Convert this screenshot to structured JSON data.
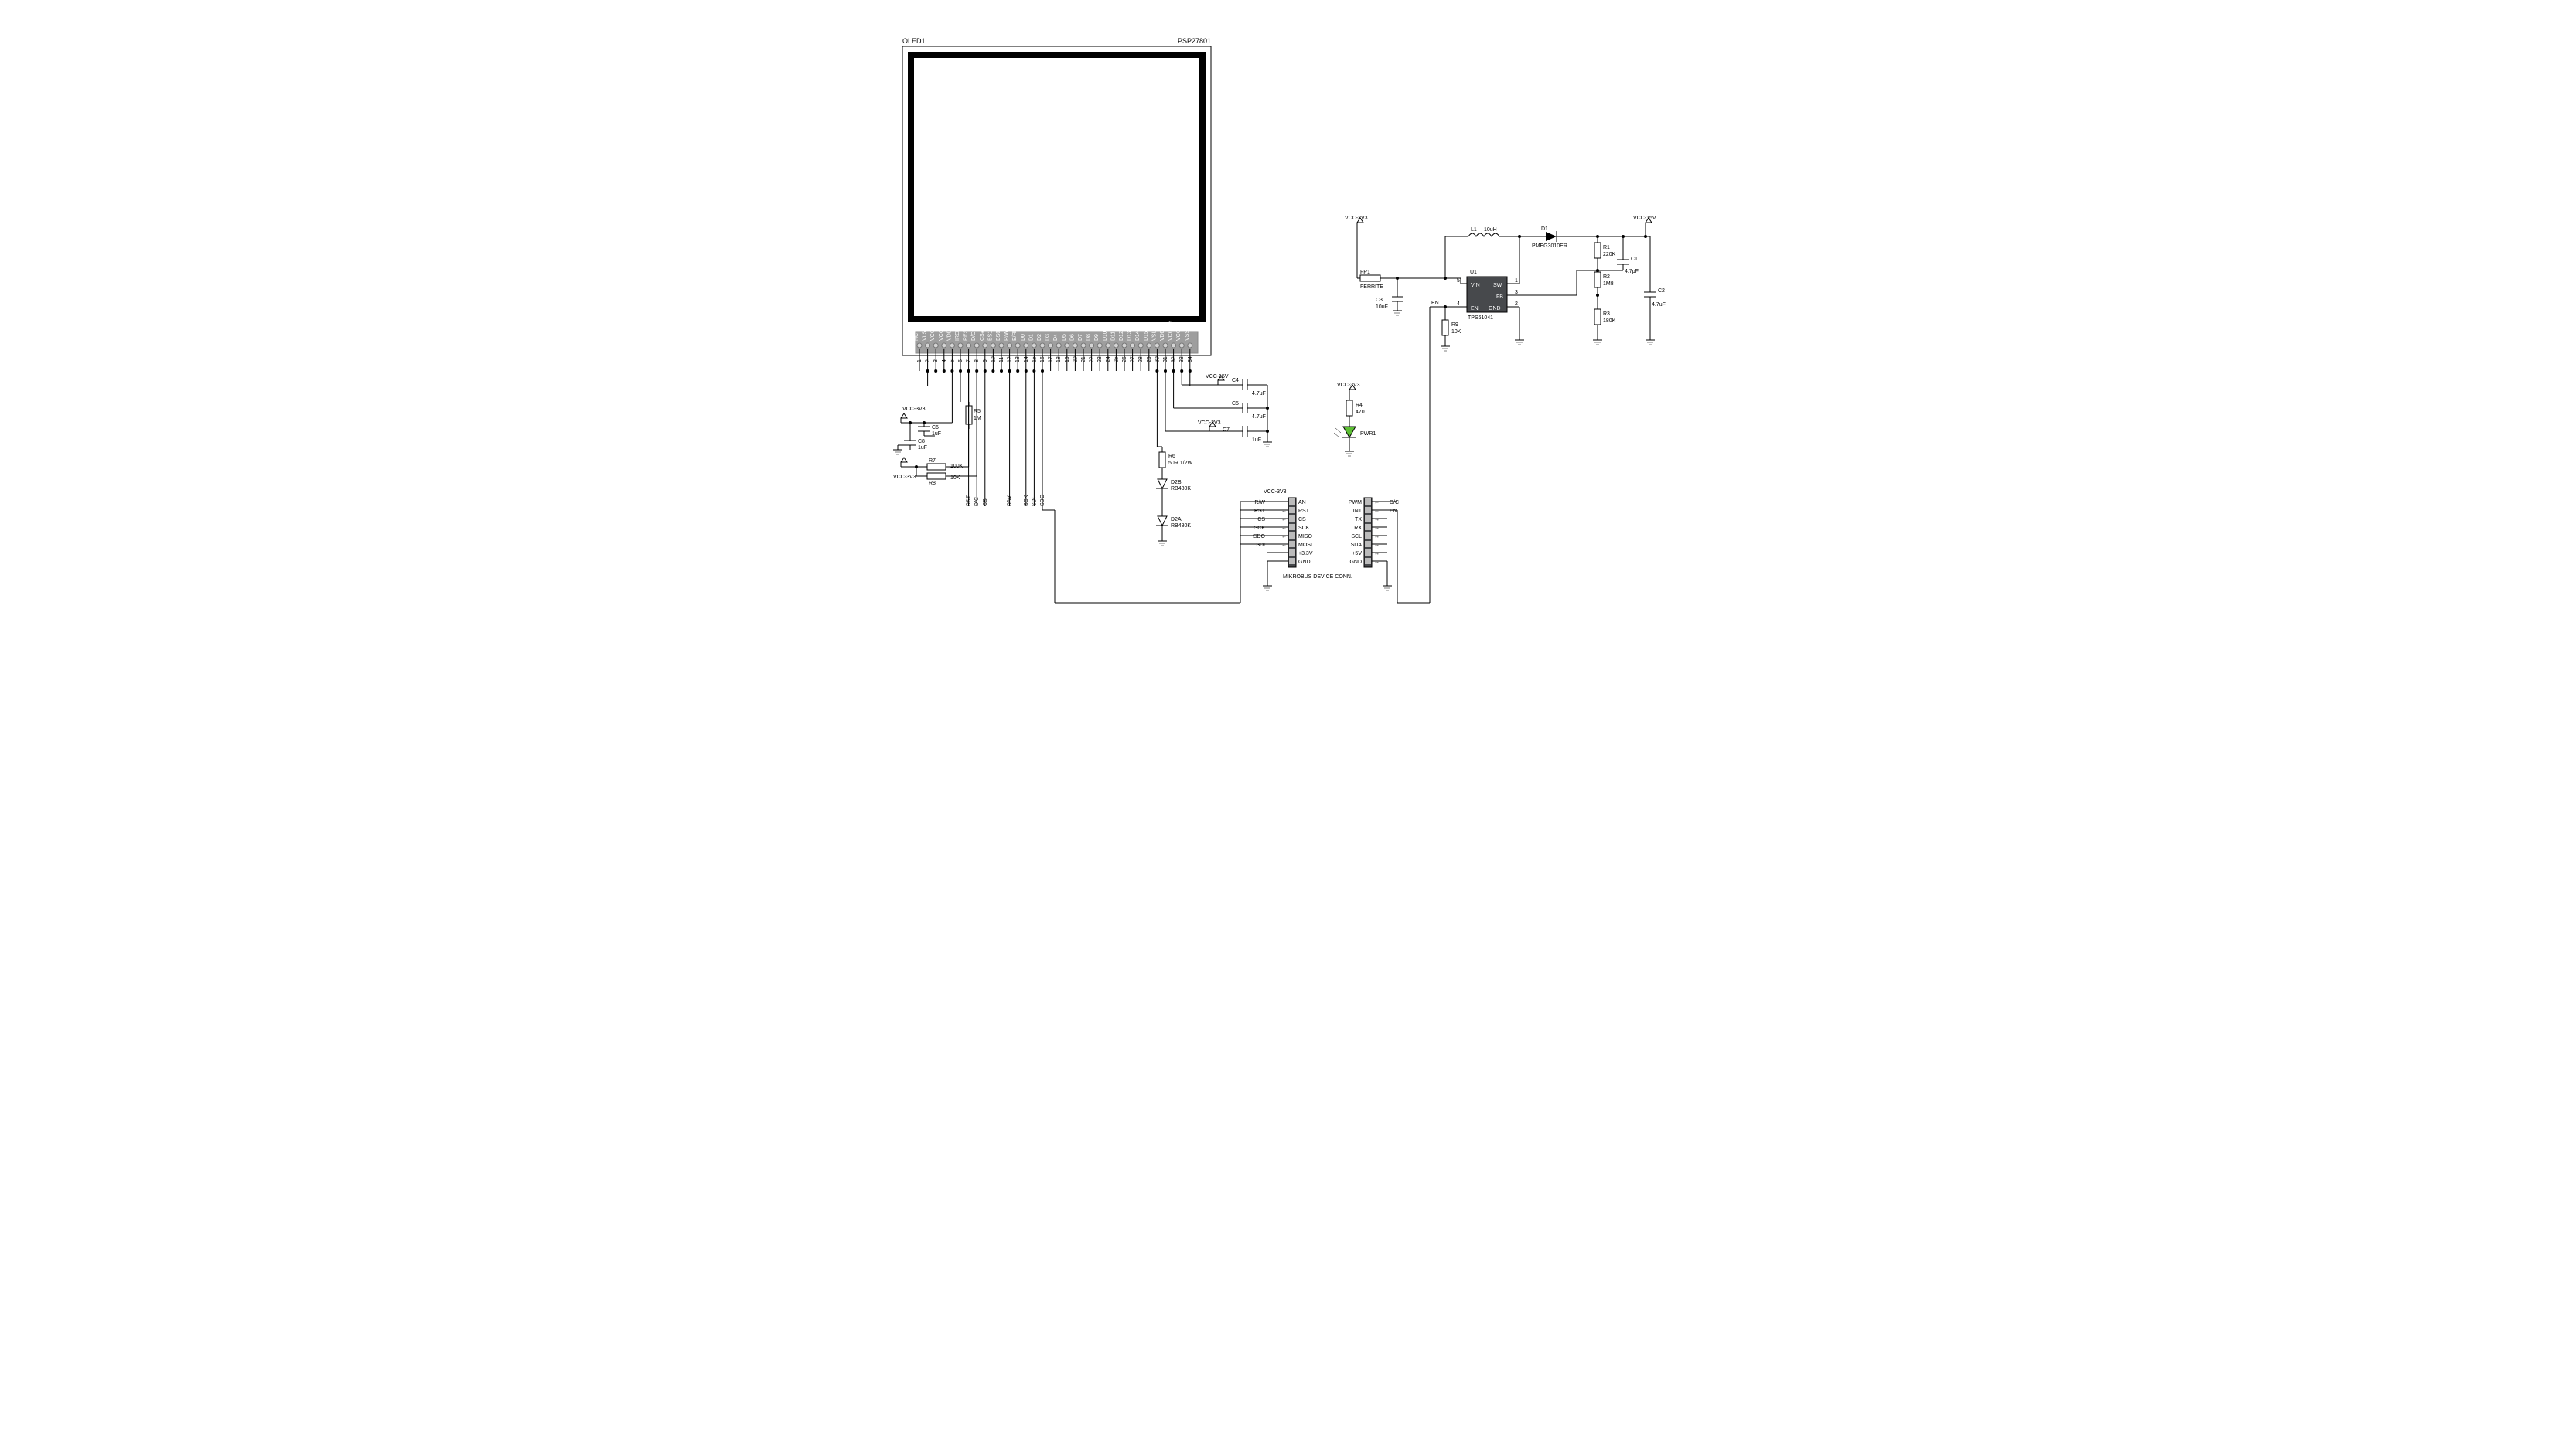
{
  "oled": {
    "ref": "OLED1",
    "part": "PSP27801",
    "pin_first": "1",
    "pin_last": "34",
    "pins": [
      "NC",
      "VLSS",
      "VCC",
      "VCCI",
      "VDD",
      "IREF",
      "RES#",
      "D/C#",
      "CS#",
      "BS1",
      "BS0",
      "R/W#",
      "E/RD#",
      "D0",
      "D1",
      "D2",
      "D3",
      "D4",
      "D5",
      "D6",
      "D7",
      "D8",
      "D9",
      "D10",
      "D11",
      "D12",
      "D13",
      "D14",
      "D15",
      "VSL",
      "VDDIO",
      "VCOMH",
      "VCC",
      "VSS"
    ],
    "pin_nums": [
      "1",
      "2",
      "3",
      "4",
      "5",
      "6",
      "7",
      "8",
      "9",
      "10",
      "11",
      "12",
      "13",
      "14",
      "15",
      "16",
      "17",
      "18",
      "19",
      "20",
      "21",
      "22",
      "23",
      "24",
      "25",
      "26",
      "27",
      "28",
      "29",
      "30",
      "31",
      "32",
      "33",
      "34"
    ]
  },
  "rails": {
    "vcc33_1": "VCC-3V3",
    "vcc33_2": "VCC-3V3",
    "vcc33_3": "VCC-3V3",
    "vcc33_4": "VCC-3V3",
    "vcc33_5": "VCC-3V3",
    "vcc33_6": "VCC-3V3",
    "vcc15_1": "VCC-15V",
    "vcc15_2": "VCC-15V"
  },
  "comp": {
    "C1": {
      "ref": "C1",
      "val": "4.7pF"
    },
    "C2": {
      "ref": "C2",
      "val": "4.7uF"
    },
    "C3": {
      "ref": "C3",
      "val": "10uF"
    },
    "C4": {
      "ref": "C4",
      "val": "4.7uF"
    },
    "C5": {
      "ref": "C5",
      "val": "4.7uF"
    },
    "C6": {
      "ref": "C6",
      "val": "1uF"
    },
    "C7": {
      "ref": "C7",
      "val": "1uF"
    },
    "C8": {
      "ref": "C8",
      "val": "1uF"
    },
    "R1": {
      "ref": "R1",
      "val": "220K"
    },
    "R2": {
      "ref": "R2",
      "val": "1M8"
    },
    "R3": {
      "ref": "R3",
      "val": "180K"
    },
    "R4": {
      "ref": "R4",
      "val": "470"
    },
    "R5": {
      "ref": "R5",
      "val": "1M"
    },
    "R6": {
      "ref": "R6",
      "val": "50R  1/2W"
    },
    "R7": {
      "ref": "R7",
      "val": "100K"
    },
    "R8": {
      "ref": "R8",
      "val": "10K"
    },
    "R9": {
      "ref": "R9",
      "val": "10K"
    },
    "L1": {
      "ref": "L1",
      "val": "10uH"
    },
    "D1": {
      "ref": "D1",
      "val": "PMEG3010ER"
    },
    "D2A": {
      "ref": "D2A",
      "val": "RB480K"
    },
    "D2B": {
      "ref": "D2B",
      "val": "RB480K"
    },
    "FP1": {
      "ref": "FP1",
      "val": "FERRITE"
    },
    "PWR1": {
      "ref": "PWR1"
    }
  },
  "u1": {
    "ref": "U1",
    "part": "TPS61041",
    "pins": {
      "VIN": "VIN",
      "SW": "SW",
      "FB": "FB",
      "EN": "EN",
      "GND": "GND"
    },
    "pin_nums": {
      "1": "1",
      "2": "2",
      "3": "3",
      "4": "4",
      "5": "5"
    }
  },
  "mikrobus": {
    "title": "MIKROBUS  DEVICE  CONN.",
    "left_labels": [
      "AN",
      "RST",
      "CS",
      "SCK",
      "MISO",
      "MOSI",
      "+3.3V",
      "GND"
    ],
    "right_labels": [
      "PWM",
      "INT",
      "TX",
      "RX",
      "SCL",
      "SDA",
      "+5V",
      "GND"
    ],
    "ext_left": [
      "R/W",
      "RST",
      "CS",
      "SCK",
      "SDO",
      "SDI"
    ],
    "ext_right": [
      "D/C",
      "EN"
    ],
    "vcc": "VCC-3V3"
  },
  "nets": {
    "RST": "RST",
    "DC": "D/C",
    "CS": "CS",
    "RW": "R/W",
    "SCK": "SCK",
    "SDI": "SDI",
    "SDO": "SDO",
    "EN": "EN"
  }
}
